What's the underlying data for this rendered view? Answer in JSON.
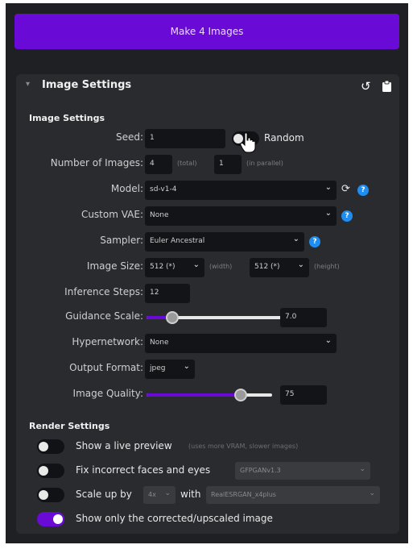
{
  "make_button": {
    "label": "Make 4 Images"
  },
  "panel": {
    "title": "Image Settings",
    "collapse_icon": "chevron-down-icon",
    "reset_icon": "undo-icon",
    "clipboard_icon": "clipboard-icon"
  },
  "image_settings": {
    "section_title": "Image Settings",
    "seed": {
      "label": "Seed:",
      "value": "1",
      "random_label": "Random",
      "random_on": false
    },
    "num_images": {
      "label": "Number of Images:",
      "total_value": "4",
      "total_hint": "(total)",
      "parallel_value": "1",
      "parallel_hint": "(in parallel)"
    },
    "model": {
      "label": "Model:",
      "value": "sd-v1-4"
    },
    "custom_vae": {
      "label": "Custom VAE:",
      "value": "None"
    },
    "sampler": {
      "label": "Sampler:",
      "value": "Euler Ancestral"
    },
    "image_size": {
      "label": "Image Size:",
      "width_value": "512 (*)",
      "width_hint": "(width)",
      "height_value": "512 (*)",
      "height_hint": "(height)"
    },
    "inference_steps": {
      "label": "Inference Steps:",
      "value": "12"
    },
    "guidance_scale": {
      "label": "Guidance Scale:",
      "value": "7.0",
      "slider_fraction": 0.17
    },
    "hypernetwork": {
      "label": "Hypernetwork:",
      "value": "None"
    },
    "output_format": {
      "label": "Output Format:",
      "value": "jpeg"
    },
    "image_quality": {
      "label": "Image Quality:",
      "value": "75",
      "slider_fraction": 0.75
    }
  },
  "render_settings": {
    "section_title": "Render Settings",
    "live_preview": {
      "label": "Show a live preview",
      "hint": "(uses more VRAM, slower images)",
      "on": false
    },
    "fix_faces": {
      "label": "Fix incorrect faces and eyes",
      "model": "GFPGANv1.3",
      "on": false
    },
    "upscale": {
      "label": "Scale up by",
      "factor": "4x",
      "with_label": "with",
      "model": "RealESRGAN_x4plus",
      "on": false
    },
    "show_corrected": {
      "label": "Show only the corrected/upscaled image",
      "on": true
    }
  },
  "colors": {
    "accent": "#6a0ad6",
    "help": "#1e8ef2",
    "panel": "#2a2b2f",
    "input": "#131417"
  }
}
